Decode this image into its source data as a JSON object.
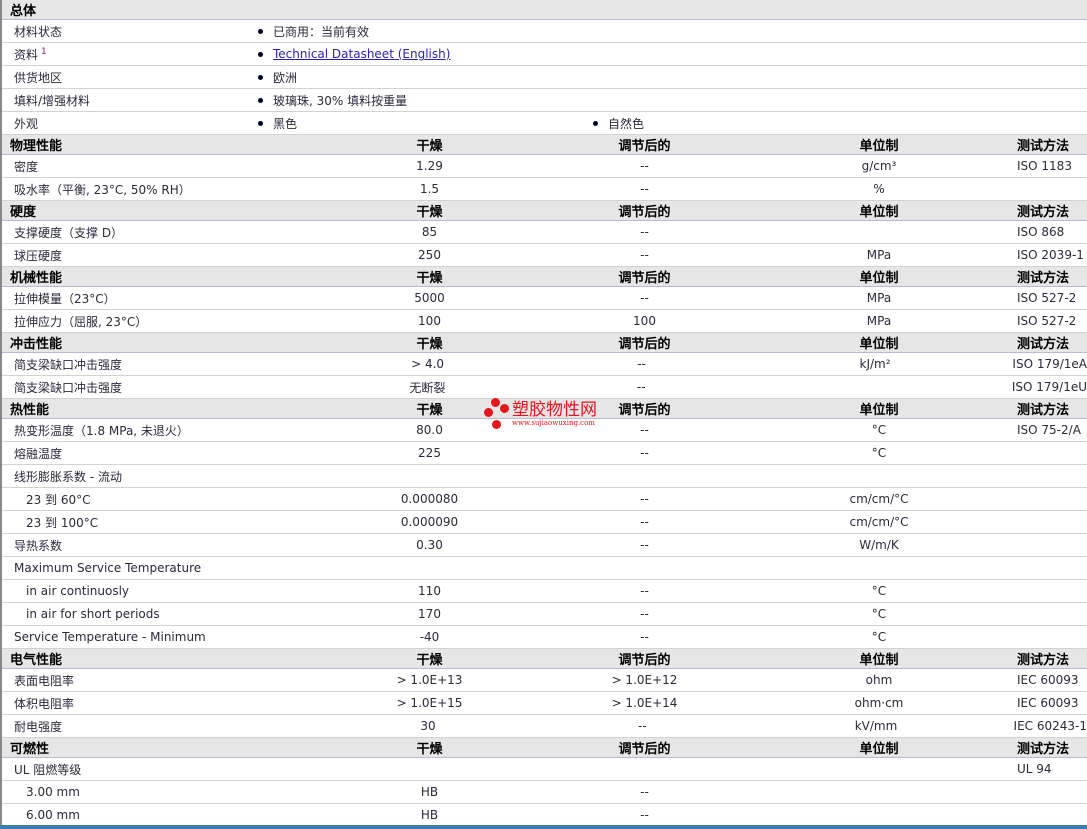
{
  "sections": [
    {
      "title": "总体",
      "general": true,
      "rows": [
        {
          "label": "材料状态",
          "values": [
            "已商用：当前有效"
          ]
        },
        {
          "label": "资料",
          "sup": "1",
          "values": [
            "Technical Datasheet (English)"
          ],
          "link": true
        },
        {
          "label": "供货地区",
          "values": [
            "欧洲"
          ]
        },
        {
          "label": "填料/增强材料",
          "values": [
            "玻璃珠, 30% 填料按重量"
          ]
        },
        {
          "label": "外观",
          "values": [
            "黑色",
            "自然色"
          ]
        }
      ]
    },
    {
      "title": "物理性能",
      "headers": [
        "干燥",
        "调节后的",
        "单位制",
        "测试方法"
      ],
      "rows": [
        {
          "label": "密度",
          "dry": "1.29",
          "cond": "--",
          "unit": "g/cm³",
          "method": "ISO 1183"
        },
        {
          "label": "吸水率（平衡, 23°C, 50% RH）",
          "dry": "1.5",
          "cond": "--",
          "unit": "%",
          "method": ""
        }
      ]
    },
    {
      "title": "硬度",
      "headers": [
        "干燥",
        "调节后的",
        "单位制",
        "测试方法"
      ],
      "rows": [
        {
          "label": "支撑硬度（支撑 D）",
          "dry": "85",
          "cond": "--",
          "unit": "",
          "method": "ISO 868"
        },
        {
          "label": "球压硬度",
          "dry": "250",
          "cond": "--",
          "unit": "MPa",
          "method": "ISO 2039-1"
        }
      ]
    },
    {
      "title": "机械性能",
      "headers": [
        "干燥",
        "调节后的",
        "单位制",
        "测试方法"
      ],
      "rows": [
        {
          "label": "拉伸模量（23°C）",
          "dry": "5000",
          "cond": "--",
          "unit": "MPa",
          "method": "ISO 527-2"
        },
        {
          "label": "拉伸应力（屈服, 23°C）",
          "dry": "100",
          "cond": "100",
          "unit": "MPa",
          "method": "ISO 527-2"
        }
      ]
    },
    {
      "title": "冲击性能",
      "headers": [
        "干燥",
        "调节后的",
        "单位制",
        "测试方法"
      ],
      "rows": [
        {
          "label": "简支梁缺口冲击强度",
          "dry": "> 4.0",
          "cond": "--",
          "unit": "kJ/m²",
          "method": "ISO 179/1eA"
        },
        {
          "label": "简支梁缺口冲击强度",
          "dry": "无断裂",
          "cond": "--",
          "unit": "",
          "method": "ISO 179/1eU"
        }
      ]
    },
    {
      "title": "热性能",
      "headers": [
        "干燥",
        "调节后的",
        "单位制",
        "测试方法"
      ],
      "rows": [
        {
          "label": "热变形温度（1.8 MPa, 未退火）",
          "dry": "80.0",
          "cond": "--",
          "unit": "°C",
          "method": "ISO 75-2/A"
        },
        {
          "label": "熔融温度",
          "dry": "225",
          "cond": "--",
          "unit": "°C",
          "method": ""
        },
        {
          "label": "线形膨胀系数 - 流动",
          "dry": "",
          "cond": "",
          "unit": "",
          "method": ""
        },
        {
          "label": "23 到  60°C",
          "indent": true,
          "dry": "0.000080",
          "cond": "--",
          "unit": "cm/cm/°C",
          "method": ""
        },
        {
          "label": "23 到  100°C",
          "indent": true,
          "dry": "0.000090",
          "cond": "--",
          "unit": "cm/cm/°C",
          "method": ""
        },
        {
          "label": "导热系数",
          "dry": "0.30",
          "cond": "--",
          "unit": "W/m/K",
          "method": ""
        },
        {
          "label": "Maximum Service Temperature",
          "dry": "",
          "cond": "",
          "unit": "",
          "method": ""
        },
        {
          "label": "in air continuosly",
          "indent": true,
          "dry": "110",
          "cond": "--",
          "unit": "°C",
          "method": ""
        },
        {
          "label": "in air for short periods",
          "indent": true,
          "dry": "170",
          "cond": "--",
          "unit": "°C",
          "method": ""
        },
        {
          "label": "Service Temperature - Minimum",
          "dry": "-40",
          "cond": "--",
          "unit": "°C",
          "method": ""
        }
      ]
    },
    {
      "title": "电气性能",
      "headers": [
        "干燥",
        "调节后的",
        "单位制",
        "测试方法"
      ],
      "rows": [
        {
          "label": "表面电阻率",
          "dry": "> 1.0E+13",
          "cond": "> 1.0E+12",
          "unit": "ohm",
          "method": "IEC 60093"
        },
        {
          "label": "体积电阻率",
          "dry": "> 1.0E+15",
          "cond": "> 1.0E+14",
          "unit": "ohm·cm",
          "method": "IEC 60093"
        },
        {
          "label": "耐电强度",
          "dry": "30",
          "cond": "--",
          "unit": "kV/mm",
          "method": "IEC 60243-1"
        }
      ]
    },
    {
      "title": "可燃性",
      "headers": [
        "干燥",
        "调节后的",
        "单位制",
        "测试方法"
      ],
      "rows": [
        {
          "label": "UL 阻燃等级",
          "dry": "",
          "cond": "",
          "unit": "",
          "method": "UL 94"
        },
        {
          "label": "3.00 mm",
          "indent": true,
          "dry": "HB",
          "cond": "--",
          "unit": "",
          "method": ""
        },
        {
          "label": "6.00 mm",
          "indent": true,
          "dry": "HB",
          "cond": "--",
          "unit": "",
          "method": ""
        }
      ]
    }
  ],
  "watermark": {
    "name": "塑胶物性网",
    "url": "www.sujiaowuxing.com"
  }
}
